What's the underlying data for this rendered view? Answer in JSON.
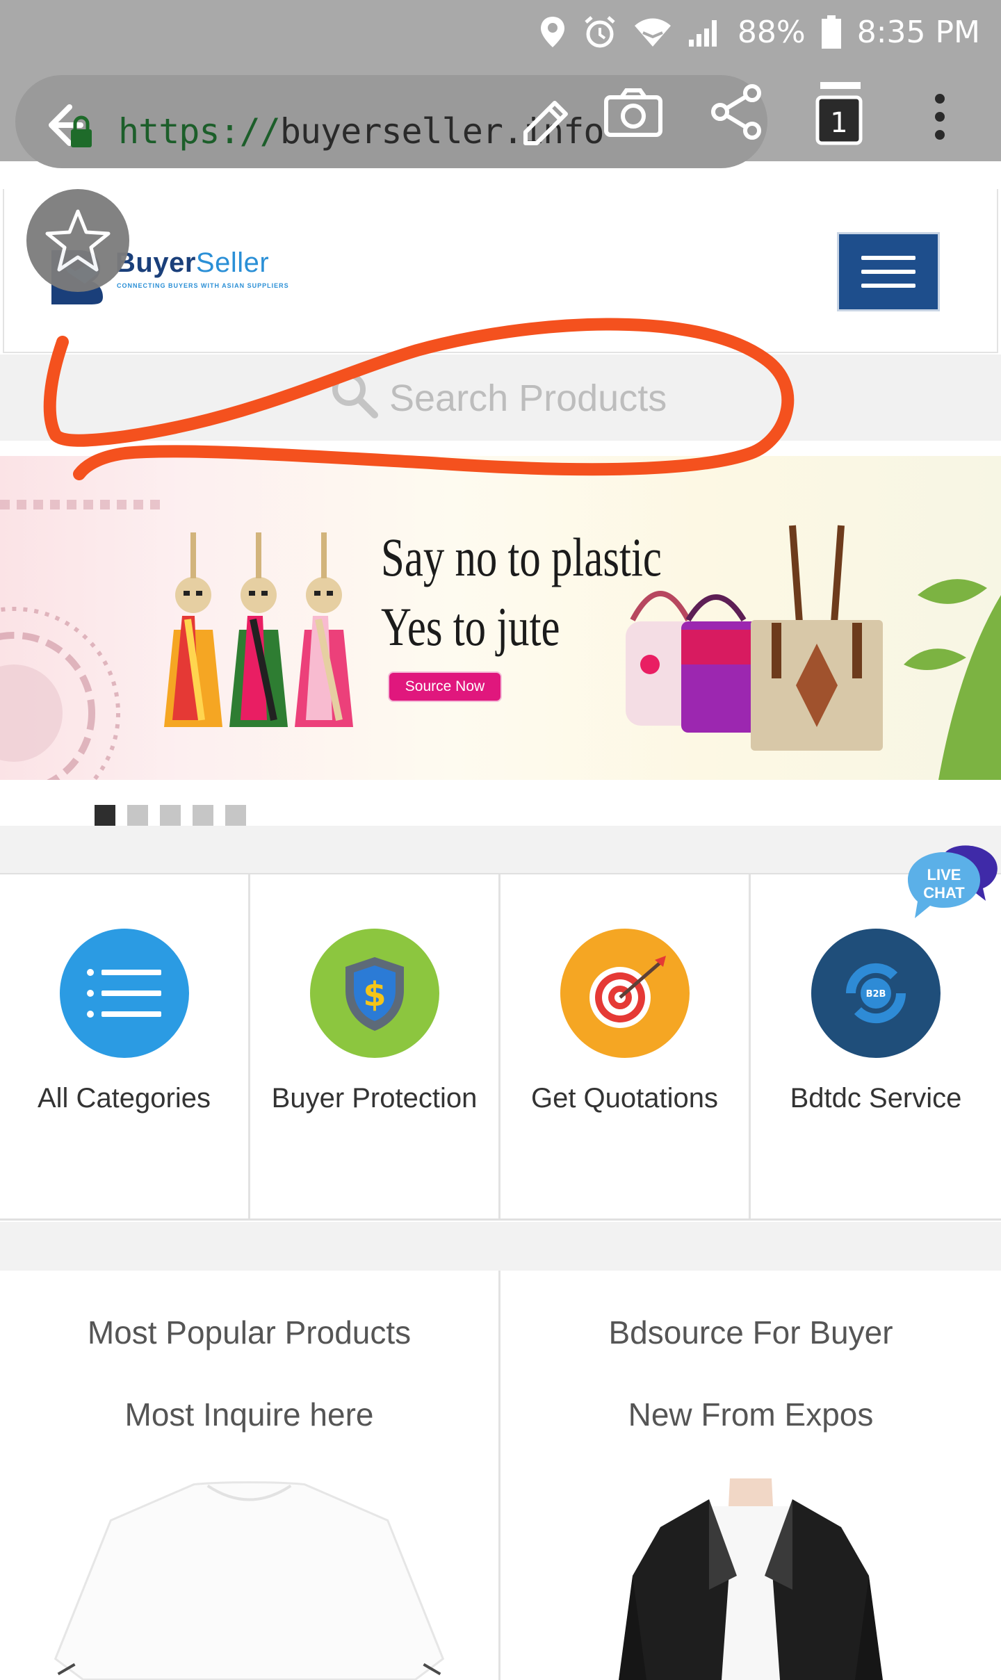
{
  "status_bar": {
    "battery": "88%",
    "time": "8:35 PM"
  },
  "browser": {
    "url_scheme": "https://",
    "url_host": "buyerseller.info"
  },
  "site": {
    "logo_word_buyer": "Buyer",
    "logo_word_seller": "Seller",
    "logo_tagline": "CONNECTING BUYERS WITH ASIAN SUPPLIERS"
  },
  "search": {
    "placeholder": "Search Products"
  },
  "banner": {
    "line1": "Say no to plastic",
    "line2": "Yes to jute",
    "cta": "Source Now",
    "dots_total": 5,
    "dots_active_index": 0
  },
  "live_chat": {
    "line1": "LIVE",
    "line2": "CHAT"
  },
  "tiles": [
    {
      "label": "All Categories",
      "icon": "list-icon",
      "color": "#2b9be3"
    },
    {
      "label": "Buyer Protection",
      "icon": "shield-dollar-icon",
      "color": "#8cc63f"
    },
    {
      "label": "Get Quotations",
      "icon": "target-icon",
      "color": "#f5a623"
    },
    {
      "label": "Bdtdc Service",
      "icon": "b2b-cycle-icon",
      "color": "#1f4e7a"
    }
  ],
  "products": {
    "left": {
      "title": "Most Popular Products",
      "subtitle": "Most Inquire here",
      "image": "white-tshirt"
    },
    "right": {
      "title": "Bdsource For Buyer",
      "subtitle": "New From Expos",
      "image": "black-leather-jacket"
    }
  },
  "colors": {
    "header_blue": "#1e4e8c",
    "annotation_orange": "#f4511e",
    "cta_pink": "#e0177d"
  }
}
